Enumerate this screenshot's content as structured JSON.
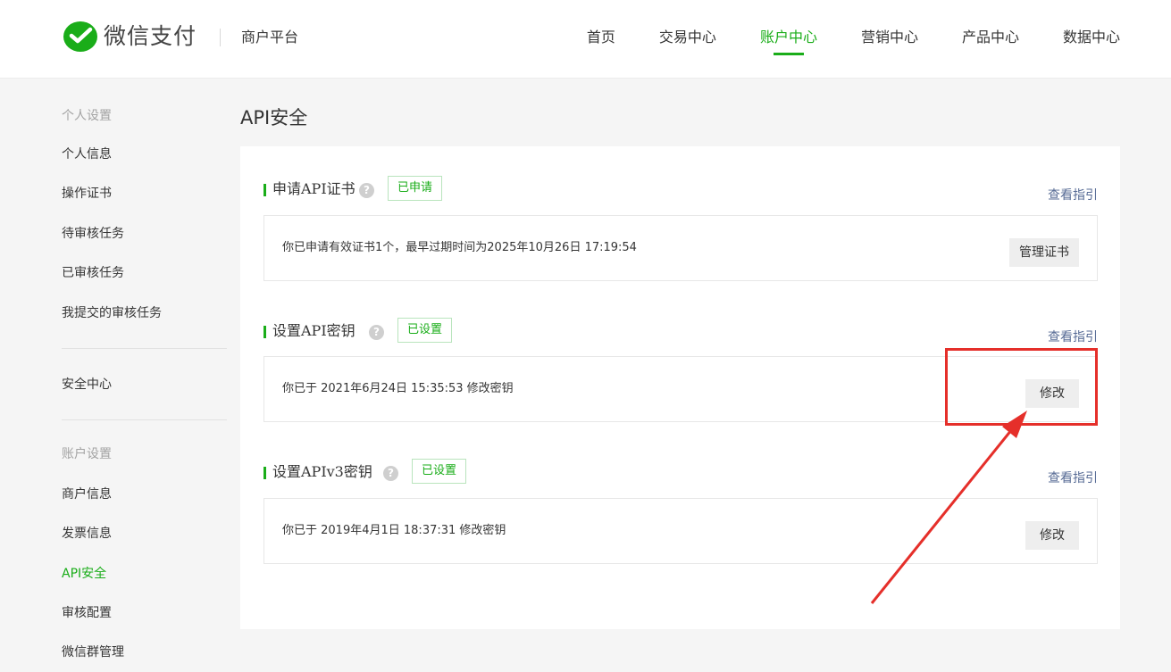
{
  "header": {
    "brand_name": "微信支付",
    "platform_name": "商户平台",
    "nav": [
      {
        "label": "首页",
        "active": false
      },
      {
        "label": "交易中心",
        "active": false
      },
      {
        "label": "账户中心",
        "active": true
      },
      {
        "label": "营销中心",
        "active": false
      },
      {
        "label": "产品中心",
        "active": false
      },
      {
        "label": "数据中心",
        "active": false
      }
    ]
  },
  "sidebar": {
    "group_personal": "个人设置",
    "personal_items": [
      "个人信息",
      "操作证书",
      "待审核任务",
      "已审核任务",
      "我提交的审核任务"
    ],
    "security_center": "安全中心",
    "group_account": "账户设置",
    "account_items": [
      {
        "label": "商户信息",
        "active": false
      },
      {
        "label": "发票信息",
        "active": false
      },
      {
        "label": "API安全",
        "active": true
      },
      {
        "label": "审核配置",
        "active": false
      },
      {
        "label": "微信群管理",
        "active": false
      }
    ]
  },
  "main": {
    "page_title": "API安全",
    "sections": [
      {
        "title": "申请API证书",
        "status": "已申请",
        "guide_link": "查看指引",
        "description": "你已申请有效证书1个，最早过期时间为2025年10月26日 17:19:54",
        "button": "管理证书"
      },
      {
        "title": "设置API密钥",
        "status": "已设置",
        "guide_link": "查看指引",
        "description": "你已于 2021年6月24日 15:35:53 修改密钥",
        "button": "修改"
      },
      {
        "title": "设置APIv3密钥",
        "status": "已设置",
        "guide_link": "查看指引",
        "description": "你已于 2019年4月1日 18:37:31 修改密钥",
        "button": "修改"
      }
    ]
  },
  "icons": {
    "logo": "wechat-pay-logo-icon",
    "help": "question-mark-icon"
  },
  "colors": {
    "accent": "#1aad19",
    "link": "#576b95",
    "annotation": "#e52f2a"
  }
}
